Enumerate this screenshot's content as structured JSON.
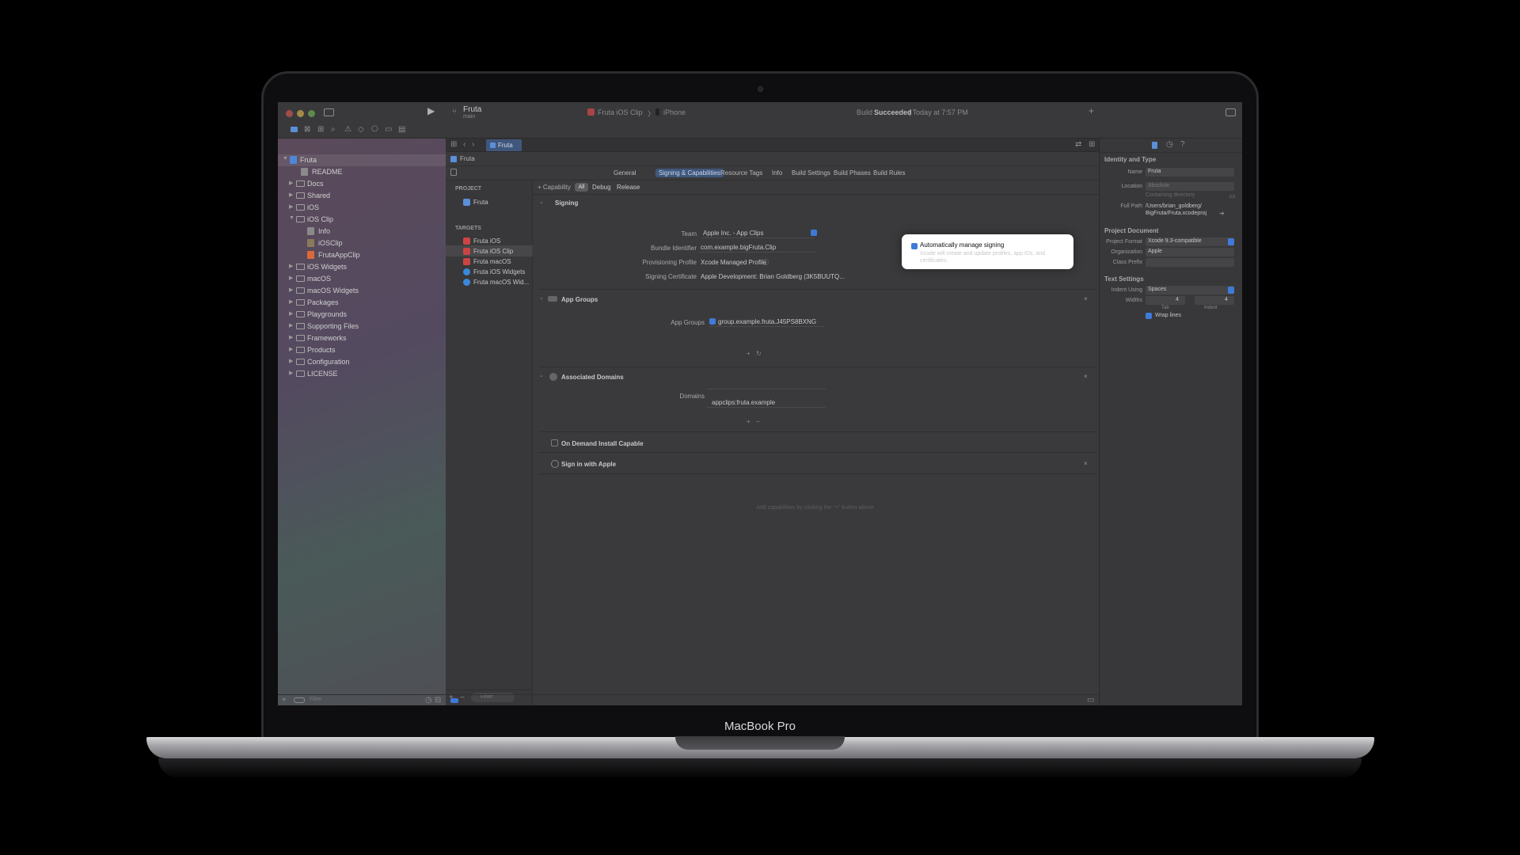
{
  "device": {
    "label": "MacBook Pro"
  },
  "toolbar": {
    "project": "Fruta",
    "branch": "main",
    "scheme": "Fruta iOS Clip",
    "destination": "iPhone",
    "status_prefix": "Build",
    "status_strong": "Succeeded",
    "status_time": "| Today at 7:57 PM"
  },
  "tab": {
    "label": "Fruta"
  },
  "navigator": {
    "root": "Fruta",
    "items": [
      {
        "label": "README"
      },
      {
        "label": "Docs"
      },
      {
        "label": "Shared"
      },
      {
        "label": "iOS"
      },
      {
        "label": "iOS Clip"
      },
      {
        "label": "Info"
      },
      {
        "label": "iOSClip"
      },
      {
        "label": "FrutaAppClip"
      },
      {
        "label": "iOS Widgets"
      },
      {
        "label": "macOS"
      },
      {
        "label": "macOS Widgets"
      },
      {
        "label": "Packages"
      },
      {
        "label": "Playgrounds"
      },
      {
        "label": "Supporting Files"
      },
      {
        "label": "Frameworks"
      },
      {
        "label": "Products"
      },
      {
        "label": "Configuration"
      },
      {
        "label": "LICENSE"
      }
    ],
    "filter_placeholder": "Filter"
  },
  "editor": {
    "breadcrumb": "Fruta",
    "tabs": [
      "General",
      "Signing & Capabilities",
      "Resource Tags",
      "Info",
      "Build Settings",
      "Build Phases",
      "Build Rules"
    ],
    "config": {
      "add": "+ Capability",
      "all": "All",
      "debug": "Debug",
      "release": "Release"
    },
    "project_header": "PROJECT",
    "project_item": "Fruta",
    "targets_header": "TARGETS",
    "targets": [
      "Fruta iOS",
      "Fruta iOS Clip",
      "Fruta macOS",
      "Fruta iOS Widgets",
      "Fruta macOS Wid..."
    ],
    "filter_placeholder": "Filter",
    "signing": {
      "header": "Signing",
      "auto_label": "Automatically manage signing",
      "auto_sub": "Xcode will create and update profiles, app IDs, and certificates.",
      "team_label": "Team",
      "team_value": "Apple Inc. - App Clips",
      "bundle_label": "Bundle Identifier",
      "bundle_value": "com.example.bigFruta.Clip",
      "profile_label": "Provisioning Profile",
      "profile_value": "Xcode Managed Profile",
      "cert_label": "Signing Certificate",
      "cert_value": "Apple Development: Brian Goldberg (3K5BUUTQ..."
    },
    "app_groups": {
      "header": "App Groups",
      "label": "App Groups",
      "value": "group.example.fruta.J45PS8BXNG"
    },
    "domains": {
      "header": "Associated Domains",
      "label": "Domains",
      "value": "appclips:fruta.example"
    },
    "on_demand": "On Demand Install Capable",
    "siwa": "Sign in with Apple",
    "hint": "Add capabilities by clicking the \"+\" button above."
  },
  "inspector": {
    "identity": {
      "header": "Identity and Type",
      "name_label": "Name",
      "name_value": "Fruta",
      "location_label": "Location",
      "location_value": "Absolute",
      "location_sub": "Containing directory",
      "path_label": "Full Path",
      "path_value1": "/Users/brian_goldberg/",
      "path_value2": "BigFruta/Fruta.xcodeproj"
    },
    "doc": {
      "header": "Project Document",
      "format_label": "Project Format",
      "format_value": "Xcode 9.3-compatible",
      "org_label": "Organization",
      "org_value": "Apple",
      "prefix_label": "Class Prefix"
    },
    "text": {
      "header": "Text Settings",
      "indent_label": "Indent Using",
      "indent_value": "Spaces",
      "widths_label": "Widths",
      "tab_value": "4",
      "indent_num": "4",
      "tab_label": "Tab",
      "indent_sub": "Indent",
      "wrap_label": "Wrap lines"
    }
  }
}
